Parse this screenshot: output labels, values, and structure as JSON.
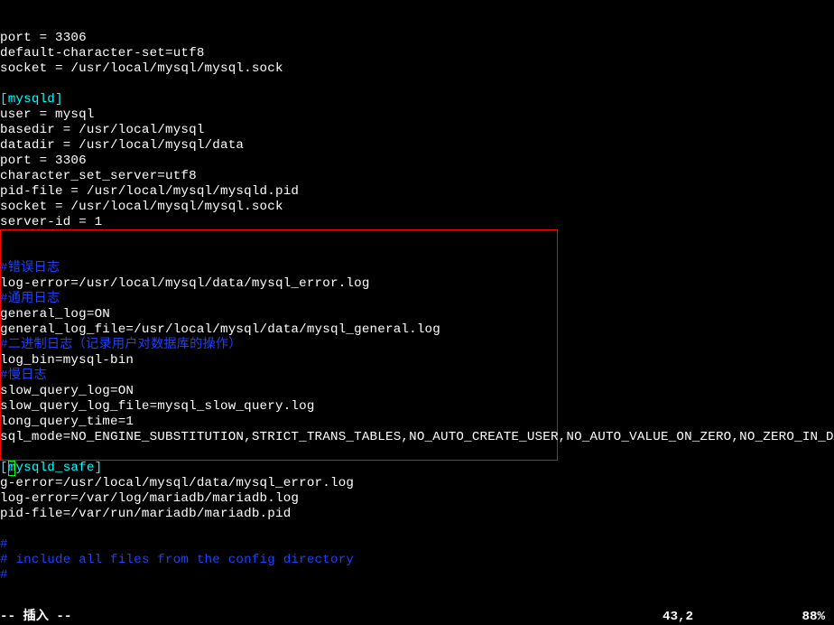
{
  "lines": [
    {
      "segments": [
        {
          "cls": "white",
          "text": "port = 3306"
        }
      ]
    },
    {
      "segments": [
        {
          "cls": "white",
          "text": "default-character-set=utf8"
        }
      ]
    },
    {
      "segments": [
        {
          "cls": "white",
          "text": "socket = /usr/local/mysql/mysql.sock"
        }
      ]
    },
    {
      "segments": [
        {
          "cls": "white",
          "text": ""
        }
      ]
    },
    {
      "segments": [
        {
          "cls": "cyan",
          "text": "[mysqld]"
        }
      ]
    },
    {
      "segments": [
        {
          "cls": "white",
          "text": "user = mysql"
        }
      ]
    },
    {
      "segments": [
        {
          "cls": "white",
          "text": "basedir = /usr/local/mysql"
        }
      ]
    },
    {
      "segments": [
        {
          "cls": "white",
          "text": "datadir = /usr/local/mysql/data"
        }
      ]
    },
    {
      "segments": [
        {
          "cls": "white",
          "text": "port = 3306"
        }
      ]
    },
    {
      "segments": [
        {
          "cls": "white",
          "text": "character_set_server=utf8"
        }
      ]
    },
    {
      "segments": [
        {
          "cls": "white",
          "text": "pid-file = /usr/local/mysql/mysqld.pid"
        }
      ]
    },
    {
      "segments": [
        {
          "cls": "white",
          "text": "socket = /usr/local/mysql/mysql.sock"
        }
      ]
    },
    {
      "segments": [
        {
          "cls": "white",
          "text": "server-id = 1"
        }
      ]
    },
    {
      "segments": [
        {
          "cls": "white",
          "text": ""
        }
      ]
    },
    {
      "segments": [
        {
          "cls": "white",
          "text": ""
        }
      ]
    },
    {
      "segments": [
        {
          "cls": "blue",
          "text": "#错误日志"
        }
      ]
    },
    {
      "segments": [
        {
          "cls": "white",
          "text": "log-error=/usr/local/mysql/data/mysql_error.log"
        }
      ]
    },
    {
      "segments": [
        {
          "cls": "blue",
          "text": "#通用日志"
        }
      ]
    },
    {
      "segments": [
        {
          "cls": "white",
          "text": "general_log=ON"
        }
      ]
    },
    {
      "segments": [
        {
          "cls": "white",
          "text": "general_log_file=/usr/local/mysql/data/mysql_general.log"
        }
      ]
    },
    {
      "segments": [
        {
          "cls": "blue",
          "text": "#二进制日志（记录用户对数据库的操作）"
        }
      ]
    },
    {
      "segments": [
        {
          "cls": "white",
          "text": "log_bin=mysql-bin"
        }
      ]
    },
    {
      "segments": [
        {
          "cls": "blue",
          "text": "#慢日志"
        }
      ]
    },
    {
      "segments": [
        {
          "cls": "white",
          "text": "slow_query_log=ON"
        }
      ]
    },
    {
      "segments": [
        {
          "cls": "white",
          "text": "slow_query_log_file=mysql_slow_query.log"
        }
      ]
    },
    {
      "segments": [
        {
          "cls": "white",
          "text": "long_query_time=1"
        }
      ]
    },
    {
      "segments": [
        {
          "cls": "white",
          "text": "sql_mode=NO_ENGINE_SUBSTITUTION,STRICT_TRANS_TABLES,NO_AUTO_CREATE_USER,NO_AUTO_VALUE_ON_ZERO,NO_ZERO_IN_DATE,NO_ZERO_DATE,ERROR_FOR_DIVISION_BY_ZERO,PIPES_AS_CONCAT,ANSI_QUOTES"
        }
      ]
    },
    {
      "segments": [
        {
          "cls": "white",
          "text": ""
        }
      ]
    },
    {
      "segments": [
        {
          "cls": "cyan",
          "text": "[mysqld_safe]"
        }
      ],
      "greenbox": true
    },
    {
      "segments": [
        {
          "cls": "white",
          "text": "g-error=/usr/local/mysql/data/mysql_error.log"
        }
      ]
    },
    {
      "segments": [
        {
          "cls": "white",
          "text": "log-error=/var/log/mariadb/mariadb.log"
        }
      ]
    },
    {
      "segments": [
        {
          "cls": "white",
          "text": "pid-file=/var/run/mariadb/mariadb.pid"
        }
      ]
    },
    {
      "segments": [
        {
          "cls": "white",
          "text": ""
        }
      ]
    },
    {
      "segments": [
        {
          "cls": "blue",
          "text": "#"
        }
      ]
    },
    {
      "segments": [
        {
          "cls": "blue",
          "text": "# include all files from the config directory"
        }
      ]
    },
    {
      "segments": [
        {
          "cls": "blue",
          "text": "#"
        }
      ]
    }
  ],
  "status": {
    "mode": "-- 插入 --",
    "position": "43,2",
    "percent": "88%"
  }
}
